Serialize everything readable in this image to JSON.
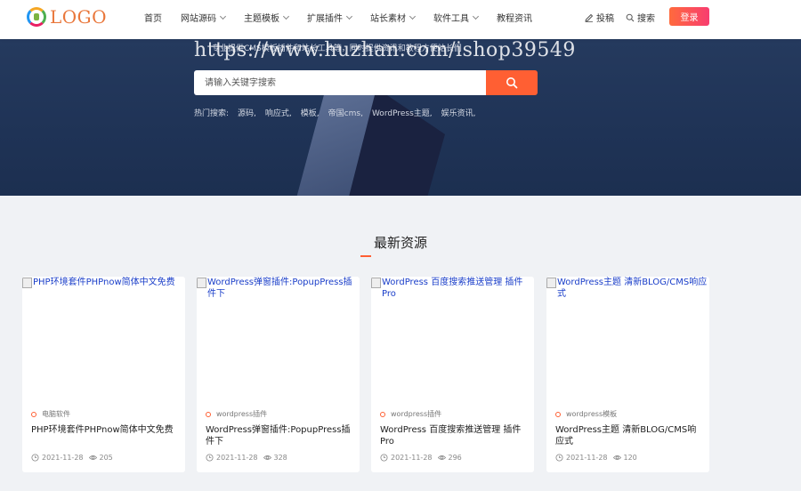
{
  "header": {
    "logo_text": "LOGO",
    "nav": [
      {
        "label": "首页",
        "dropdown": false
      },
      {
        "label": "网站源码",
        "dropdown": true
      },
      {
        "label": "主题模板",
        "dropdown": true
      },
      {
        "label": "扩展插件",
        "dropdown": true
      },
      {
        "label": "站长素材",
        "dropdown": true
      },
      {
        "label": "软件工具",
        "dropdown": true
      },
      {
        "label": "教程资讯",
        "dropdown": false
      }
    ],
    "submit_label": "投稿",
    "search_label": "搜索",
    "login_label": "登录"
  },
  "hero": {
    "subtitle": "专业提供CMS模板插件和站长工具等，同时提供资讯和教程方便站长们",
    "watermark": "https://www.huzhan.com/ishop39549",
    "search_placeholder": "请输入关键字搜索",
    "hot_label": "热门搜索:",
    "hot_terms": [
      "源码,",
      "响应式,",
      "模板,",
      "帝国cms,",
      "WordPress主题,",
      "娱乐资讯,"
    ]
  },
  "section": {
    "title": "最新资源"
  },
  "cards": [
    {
      "img_alt": "PHP环境套件PHPnow简体中文免费",
      "category": "电脑软件",
      "title": "PHP环境套件PHPnow简体中文免费",
      "date": "2021-11-28",
      "views": "205"
    },
    {
      "img_alt": "WordPress弹窗插件:PopupPress插件下",
      "category": "wordpress插件",
      "title": "WordPress弹窗插件:PopupPress插件下",
      "date": "2021-11-28",
      "views": "328"
    },
    {
      "img_alt": "WordPress 百度搜索推送管理 插件Pro",
      "category": "wordpress插件",
      "title": "WordPress 百度搜索推送管理 插件Pro",
      "date": "2021-11-28",
      "views": "296"
    },
    {
      "img_alt": "WordPress主题 清新BLOG/CMS响应式",
      "category": "wordpress模板",
      "title": "WordPress主题 清新BLOG/CMS响应式",
      "date": "2021-11-28",
      "views": "120"
    }
  ],
  "colors": {
    "accent": "#ff5f33",
    "hero_bg": "#22375a",
    "login_gradient_start": "#ff6a3d",
    "login_gradient_end": "#f83d70"
  }
}
